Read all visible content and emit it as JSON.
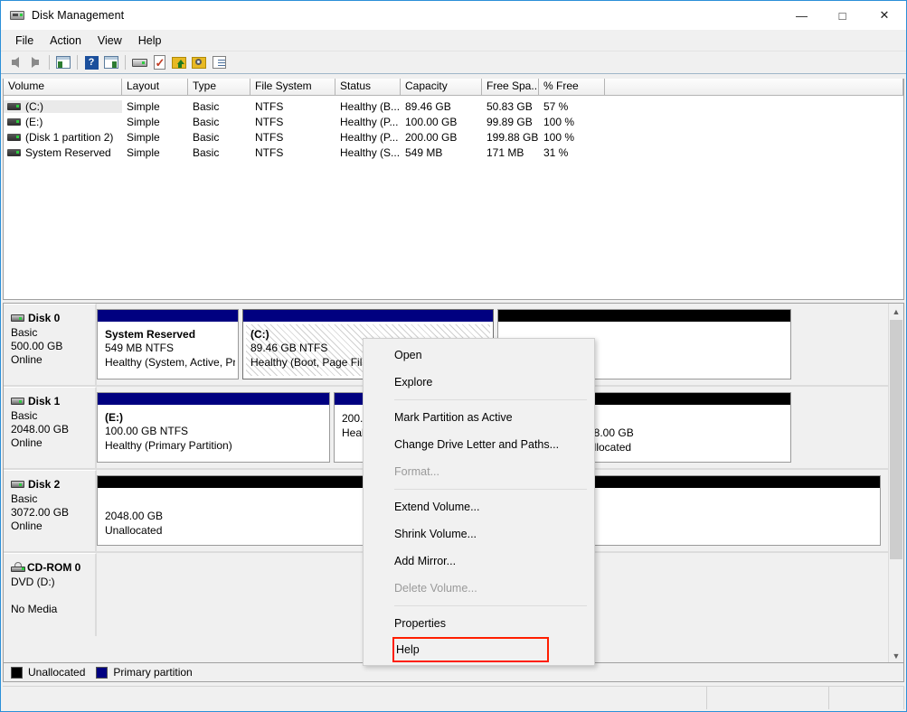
{
  "window": {
    "title": "Disk Management",
    "icon": "disk-management-icon",
    "minimize": "—",
    "maximize": "□",
    "close": "✕"
  },
  "menubar": {
    "items": [
      "File",
      "Action",
      "View",
      "Help"
    ]
  },
  "toolbar": {
    "buttons": [
      "back-arrow-icon",
      "forward-arrow-icon",
      "up-one-level-icon",
      "help-icon",
      "show-hide-console-tree-icon",
      "disk-properties-icon",
      "check-disk-icon",
      "folder-up-icon",
      "search-icon",
      "list-properties-icon"
    ]
  },
  "volume_list": {
    "columns": [
      "Volume",
      "Layout",
      "Type",
      "File System",
      "Status",
      "Capacity",
      "Free Spa...",
      "% Free"
    ],
    "rows": [
      {
        "volume": "(C:)",
        "layout": "Simple",
        "type": "Basic",
        "fs": "NTFS",
        "status": "Healthy (B...",
        "capacity": "89.46 GB",
        "free": "50.83 GB",
        "pct": "57 %",
        "selected": true
      },
      {
        "volume": "(E:)",
        "layout": "Simple",
        "type": "Basic",
        "fs": "NTFS",
        "status": "Healthy (P...",
        "capacity": "100.00 GB",
        "free": "99.89 GB",
        "pct": "100 %",
        "selected": false
      },
      {
        "volume": "(Disk 1 partition 2)",
        "layout": "Simple",
        "type": "Basic",
        "fs": "NTFS",
        "status": "Healthy (P...",
        "capacity": "200.00 GB",
        "free": "199.88 GB",
        "pct": "100 %",
        "selected": false
      },
      {
        "volume": "System Reserved",
        "layout": "Simple",
        "type": "Basic",
        "fs": "NTFS",
        "status": "Healthy (S...",
        "capacity": "549 MB",
        "free": "171 MB",
        "pct": "31 %",
        "selected": false
      }
    ]
  },
  "disks": [
    {
      "name": "Disk 0",
      "kind": "Basic",
      "size": "500.00 GB",
      "state": "Online",
      "icon": "hard-disk-icon",
      "partitions": [
        {
          "title": "System Reserved",
          "line2": "549 MB NTFS",
          "line3": "Healthy (System, Active, Pr",
          "bar": "primary",
          "hatched": false
        },
        {
          "title": "(C:)",
          "line2": "89.46 GB NTFS",
          "line3": "Healthy (Boot, Page File",
          "bar": "primary",
          "hatched": true
        },
        {
          "title": "",
          "line2": "",
          "line3": "",
          "bar": "unalloc",
          "hatched": false
        }
      ]
    },
    {
      "name": "Disk 1",
      "kind": "Basic",
      "size": "2048.00 GB",
      "state": "Online",
      "icon": "hard-disk-icon",
      "partitions": [
        {
          "title": "(E:)",
          "line2": "100.00 GB NTFS",
          "line3": "Healthy (Primary Partition)",
          "bar": "primary",
          "hatched": false
        },
        {
          "title": "",
          "line2": "200.0",
          "line3": "Healt",
          "bar": "primary",
          "hatched": false
        },
        {
          "title": "",
          "line2": "48.00 GB",
          "line3": "allocated",
          "bar": "unalloc",
          "hatched": false
        }
      ]
    },
    {
      "name": "Disk 2",
      "kind": "Basic",
      "size": "3072.00 GB",
      "state": "Online",
      "icon": "hard-disk-icon",
      "partitions": [
        {
          "title": "",
          "line2": "2048.00 GB",
          "line3": "Unallocated",
          "bar": "unalloc",
          "hatched": false
        }
      ]
    },
    {
      "name": "CD-ROM 0",
      "kind": "DVD (D:)",
      "size": "",
      "state": "No Media",
      "icon": "cdrom-icon",
      "partitions": []
    }
  ],
  "context_menu": {
    "items": [
      {
        "label": "Open",
        "disabled": false,
        "highlighted": false,
        "sep_after": false
      },
      {
        "label": "Explore",
        "disabled": false,
        "highlighted": false,
        "sep_after": true
      },
      {
        "label": "Mark Partition as Active",
        "disabled": false,
        "highlighted": false,
        "sep_after": false
      },
      {
        "label": "Change Drive Letter and Paths...",
        "disabled": false,
        "highlighted": false,
        "sep_after": false
      },
      {
        "label": "Format...",
        "disabled": true,
        "highlighted": false,
        "sep_after": true
      },
      {
        "label": "Extend Volume...",
        "disabled": false,
        "highlighted": false,
        "sep_after": false
      },
      {
        "label": "Shrink Volume...",
        "disabled": false,
        "highlighted": false,
        "sep_after": false
      },
      {
        "label": "Add Mirror...",
        "disabled": false,
        "highlighted": false,
        "sep_after": false
      },
      {
        "label": "Delete Volume...",
        "disabled": true,
        "highlighted": false,
        "sep_after": true
      },
      {
        "label": "Properties",
        "disabled": false,
        "highlighted": false,
        "sep_after": false
      },
      {
        "label": "Help",
        "disabled": false,
        "highlighted": true,
        "sep_after": false
      }
    ],
    "highlight_color": "#ff1e00"
  },
  "legend": {
    "items": [
      {
        "label": "Unallocated",
        "color": "#000000"
      },
      {
        "label": "Primary partition",
        "color": "#000080"
      }
    ]
  },
  "statusbar": {
    "panels": [
      "",
      "",
      "",
      ""
    ]
  },
  "colors": {
    "primary_partition": "#000080",
    "unallocated": "#000000",
    "window_border": "#2b8fd8",
    "chrome": "#f0f0f0"
  }
}
